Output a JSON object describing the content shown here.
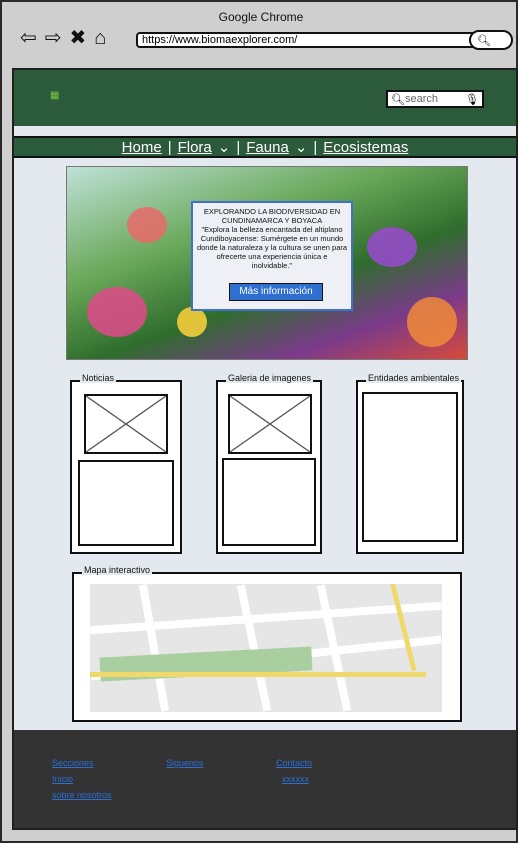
{
  "browser": {
    "app_name": "Google Chrome",
    "url": "https://www.biomaexplorer.com/"
  },
  "header": {
    "search_placeholder": "search"
  },
  "menu": [
    {
      "label": "Home",
      "has_dropdown": false
    },
    {
      "label": "Flora",
      "has_dropdown": true
    },
    {
      "label": "Fauna",
      "has_dropdown": true
    },
    {
      "label": "Ecosistemas",
      "has_dropdown": false
    }
  ],
  "hero": {
    "title": "EXPLORANDO LA BIODIVERSIDAD EN CUNDINAMARCA Y BOYACA",
    "body": "\"Explora la belleza encantada del altiplano Cundiboyacense: Sumérgete en un mundo donde la naturaleza y la cultura se unen para ofrecerte una experiencia única e inolvidable.\"",
    "button_label": "Más información"
  },
  "sections": {
    "noticias": "Noticias",
    "galeria": "Galeria de imagenes",
    "entidades": "Entidades ambientales",
    "mapa": "Mapa interactivo"
  },
  "footer": {
    "col1": [
      "Secciones",
      "Inicio",
      "sobre nosotros"
    ],
    "col2": [
      "Siguenos"
    ],
    "col3": [
      "Contacto",
      "xxxxxx"
    ]
  }
}
